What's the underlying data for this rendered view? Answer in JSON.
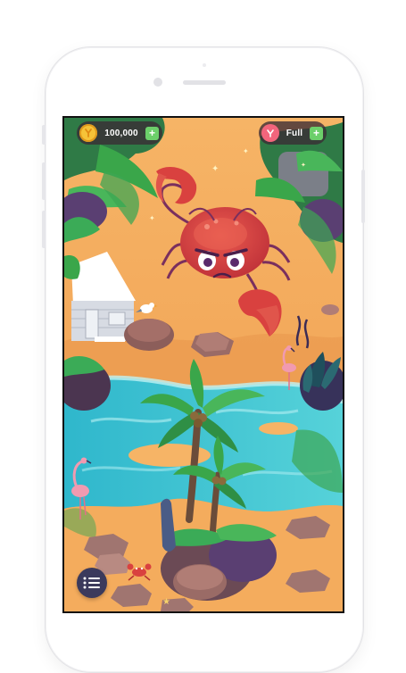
{
  "hud": {
    "coins": "100,000",
    "lives": "Full",
    "add_coins_label": "+",
    "add_lives_label": "+"
  },
  "icons": {
    "coin": "coin-icon",
    "heart": "heart-icon",
    "menu": "menu-list-icon"
  },
  "colors": {
    "sand": "#f3a85a",
    "water": "#3cc3d4",
    "palm_leaf": "#3aa64a",
    "crab": "#d9413f",
    "hud_background": "#3a2a34",
    "plus_button": "#6ccf6a",
    "menu_button": "#3b3a5c"
  }
}
